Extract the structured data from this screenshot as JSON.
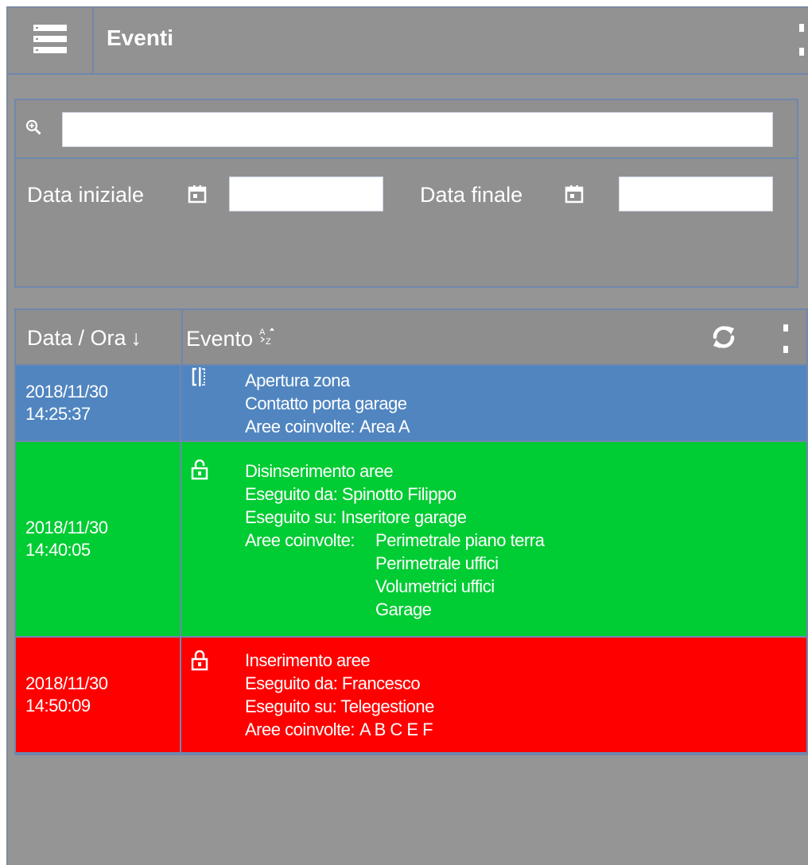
{
  "header": {
    "title": "Eventi",
    "menu_icon": "list-menu-icon",
    "more_icon": "kebab-icon"
  },
  "filters": {
    "search_icon": "zoom-in-icon",
    "search_value": "",
    "start_label": "Data iniziale",
    "start_value": "",
    "end_label": "Data finale",
    "end_value": "",
    "calendar_icon": "calendar-icon"
  },
  "table": {
    "col_datetime": "Data / Ora",
    "col_datetime_sort": "↓",
    "col_event": "Evento",
    "col_event_sort_icon": "sort-az-icon",
    "refresh_icon": "refresh-icon",
    "more_icon": "kebab-icon"
  },
  "events": [
    {
      "date": "2018/11/30",
      "time": "14:25:37",
      "color": "#5085c0",
      "icon": "zone-door-icon",
      "title": "Apertura zona",
      "line1": "Contatto porta garage",
      "areas_label": "Aree coinvolte:",
      "areas": [
        "Area A"
      ]
    },
    {
      "date": "2018/11/30",
      "time": "14:40:05",
      "color": "#00cc33",
      "icon": "unlock-icon",
      "title": "Disinserimento aree",
      "line1": "Eseguito da: Spinotto Filippo",
      "line2": "Eseguito su: Inseritore garage",
      "areas_label": "Aree coinvolte:",
      "areas": [
        "Perimetrale piano terra",
        "Perimetrale uffici",
        "Volumetrici uffici",
        "Garage"
      ]
    },
    {
      "date": "2018/11/30",
      "time": "14:50:09",
      "color": "#ff0000",
      "icon": "lock-icon",
      "title": "Inserimento aree",
      "line1": "Eseguito da: Francesco",
      "line2": "Eseguito su: Telegestione",
      "areas_label": "Aree coinvolte:",
      "areas": [
        "A B C E F"
      ]
    }
  ]
}
